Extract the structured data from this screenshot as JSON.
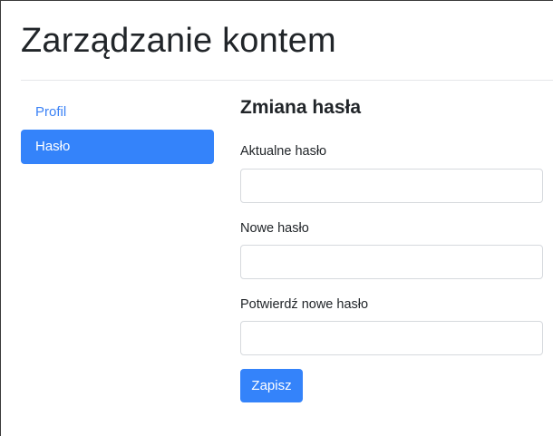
{
  "page": {
    "title": "Zarządzanie kontem"
  },
  "sidebar": {
    "items": [
      {
        "label": "Profil",
        "active": false
      },
      {
        "label": "Hasło",
        "active": true
      }
    ]
  },
  "form": {
    "title": "Zmiana hasła",
    "fields": [
      {
        "label": "Aktualne hasło",
        "value": "",
        "placeholder": ""
      },
      {
        "label": "Nowe hasło",
        "value": "",
        "placeholder": ""
      },
      {
        "label": "Potwierdź nowe hasło",
        "value": "",
        "placeholder": ""
      }
    ],
    "submit_label": "Zapisz"
  },
  "colors": {
    "accent": "#3483fa",
    "link": "#3b82f6",
    "text": "#212529",
    "border": "#d6d9dd"
  }
}
